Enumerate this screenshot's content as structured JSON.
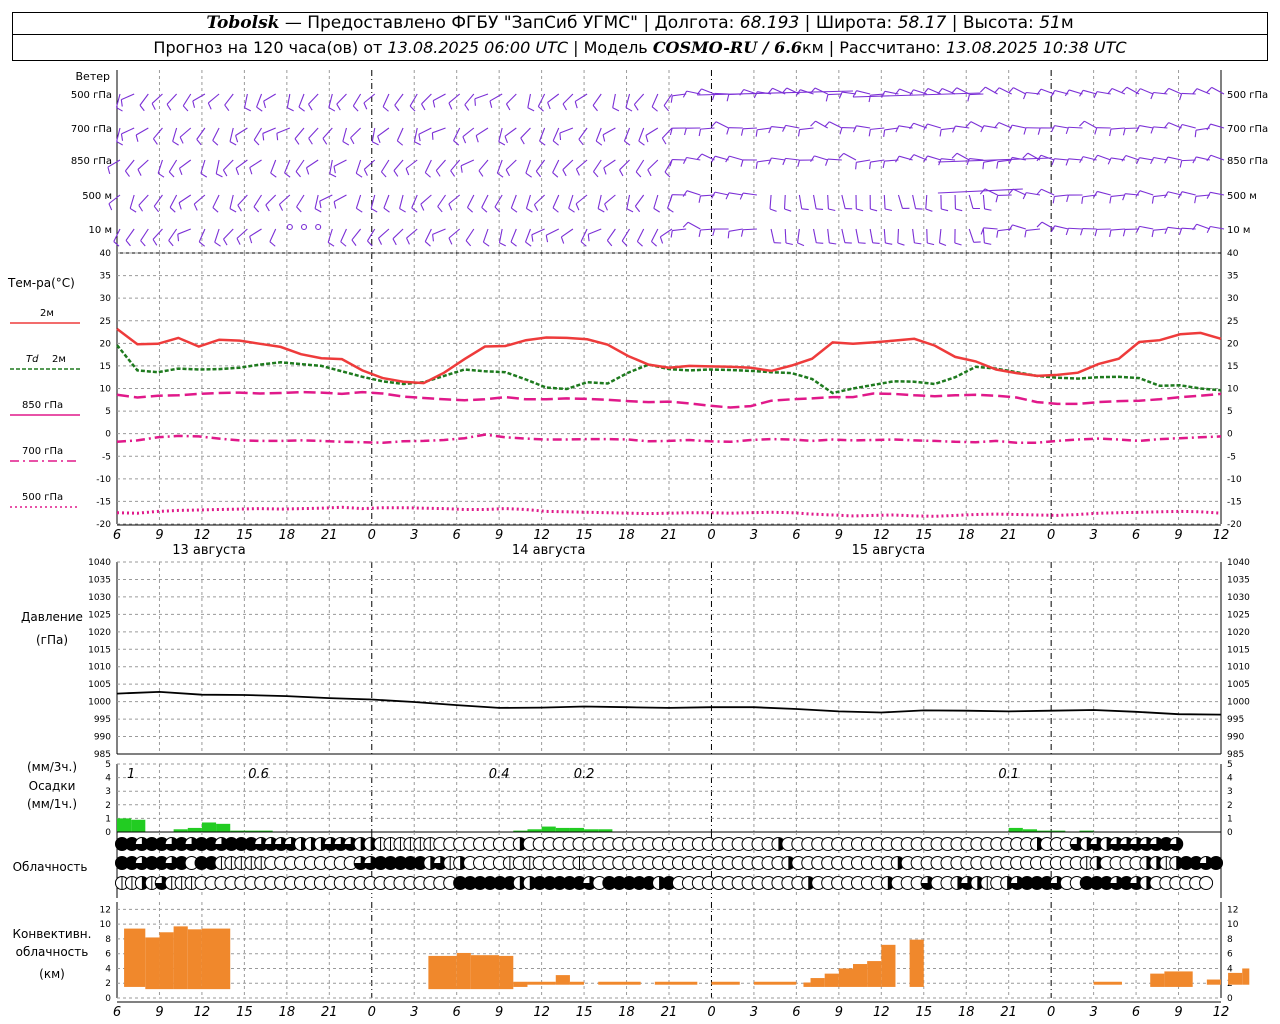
{
  "header": {
    "station": "Tobolsk",
    "provider": " — Предоставлено ФГБУ \"ЗапСиб УГМС\" | Долгота: ",
    "lon": "68.193",
    "lat_label": " | Широта: ",
    "lat": "58.17",
    "alt_label": " | Высота: ",
    "alt": "51",
    "alt_unit": "м",
    "forecast_prefix": "Прогноз на 120 часа(ов) от ",
    "forecast_date": "13.08.2025 06:00 UTC",
    "model_prefix": " | Модель ",
    "model": "COSMO-RU / 6.6",
    "model_unit": "км",
    "calc_prefix": " | Рассчитано: ",
    "calc_date": "13.08.2025 10:38 UTC"
  },
  "labels": {
    "wind": "Ветер",
    "wind_levels": [
      "500 гПа",
      "700 гПа",
      "850 гПа",
      "500 м",
      "10 м"
    ],
    "temp": "Тем-ра(°C)",
    "t2m": "2м",
    "td": "Td",
    "td2m": "2м",
    "t850": "850 гПа",
    "t700": "700 гПа",
    "t500": "500 гПа",
    "pressure": "Давление",
    "pressure_unit": "(гПа)",
    "precip_3h": "(мм/3ч.)",
    "precip": "Осадки",
    "precip_1h": "(мм/1ч.)",
    "cloud": "Облачность",
    "conv1": "Конвективн.",
    "conv2": "облачность",
    "conv3": "(км)",
    "dates": [
      "13 августа",
      "14 августа",
      "15 августа"
    ]
  },
  "colors": {
    "wind": "#7b2fd6",
    "t2m": "#ee3b3b",
    "td": "#1e7a1e",
    "t850": "#e0198a",
    "precip": "#22cc22",
    "conv": "#f0882c",
    "grid": "#9a9a9a"
  },
  "chart_data": {
    "type": "line",
    "hours": [
      6,
      9,
      12,
      15,
      18,
      21,
      0,
      3,
      6,
      9,
      12,
      15,
      18,
      21,
      0,
      3,
      6,
      9,
      12,
      15,
      18,
      21,
      0,
      3,
      6,
      9,
      12
    ],
    "temperature": {
      "ylim": [
        -20,
        40
      ],
      "ticks": [
        40,
        35,
        30,
        25,
        20,
        15,
        10,
        5,
        0,
        -5,
        -10,
        -15,
        -20
      ],
      "t2m": [
        23.2,
        19.8,
        19.9,
        21.2,
        19.3,
        20.8,
        20.6,
        19.9,
        19.2,
        17.6,
        16.7,
        16.5,
        14.0,
        12.3,
        11.5,
        11.2,
        13.5,
        16.5,
        19.3,
        19.4,
        20.7,
        21.3,
        21.2,
        20.9,
        19.7,
        17.2,
        15.3,
        14.6,
        15.0,
        14.9,
        14.8,
        14.6,
        13.9,
        15.1,
        16.6,
        20.2,
        19.9,
        20.2,
        20.6,
        21.0,
        19.5,
        17.0,
        16.0,
        14.2,
        13.4,
        12.8,
        13.0,
        13.5,
        15.4,
        16.6,
        20.3,
        20.7,
        22.0,
        22.3,
        21.0
      ],
      "td": [
        19.6,
        14.0,
        13.6,
        14.4,
        14.2,
        14.3,
        14.6,
        15.3,
        15.8,
        15.4,
        15.0,
        13.8,
        12.6,
        11.6,
        11.0,
        11.4,
        12.8,
        14.2,
        13.8,
        13.6,
        12.0,
        10.2,
        9.9,
        11.4,
        11.1,
        13.5,
        15.3,
        14.3,
        14.0,
        14.2,
        14.1,
        13.9,
        13.6,
        13.4,
        12.1,
        9.0,
        10.0,
        10.8,
        11.6,
        11.5,
        11.0,
        12.5,
        14.8,
        14.4,
        13.6,
        12.8,
        12.4,
        12.2,
        12.5,
        12.6,
        12.3,
        10.6,
        10.7,
        10.0,
        9.6
      ],
      "t850": [
        8.6,
        8.0,
        8.4,
        8.5,
        8.8,
        9.0,
        9.1,
        8.9,
        9.0,
        9.2,
        9.1,
        8.8,
        9.2,
        8.9,
        8.2,
        7.9,
        7.6,
        7.4,
        7.6,
        8.1,
        7.6,
        7.6,
        7.8,
        7.7,
        7.5,
        7.2,
        7.0,
        7.1,
        6.7,
        6.2,
        5.8,
        6.1,
        7.3,
        7.6,
        7.8,
        8.1,
        8.1,
        8.9,
        8.8,
        8.5,
        8.3,
        8.5,
        8.6,
        8.4,
        8.0,
        7.0,
        6.6,
        6.6,
        7.0,
        7.2,
        7.3,
        7.6,
        8.1,
        8.4,
        8.8
      ],
      "t700": [
        -1.8,
        -1.5,
        -0.8,
        -0.5,
        -0.6,
        -1.1,
        -1.5,
        -1.6,
        -1.6,
        -1.5,
        -1.6,
        -1.8,
        -1.9,
        -2.0,
        -1.7,
        -1.6,
        -1.4,
        -1.0,
        -0.2,
        -0.8,
        -1.1,
        -1.3,
        -1.3,
        -1.2,
        -1.2,
        -1.3,
        -1.7,
        -1.6,
        -1.4,
        -1.7,
        -1.8,
        -1.4,
        -1.2,
        -1.3,
        -1.6,
        -1.3,
        -1.5,
        -1.4,
        -1.3,
        -1.5,
        -1.6,
        -1.8,
        -1.9,
        -1.6,
        -2.0,
        -2.0,
        -1.6,
        -1.3,
        -1.1,
        -1.3,
        -1.6,
        -1.2,
        -1.0,
        -0.8,
        -0.6
      ],
      "t500": [
        -17.5,
        -17.6,
        -17.2,
        -17.0,
        -16.9,
        -16.8,
        -16.7,
        -16.6,
        -16.7,
        -16.6,
        -16.5,
        -16.3,
        -16.6,
        -16.4,
        -16.4,
        -16.5,
        -16.6,
        -16.8,
        -16.8,
        -16.6,
        -16.8,
        -17.2,
        -17.3,
        -17.4,
        -17.5,
        -17.6,
        -17.7,
        -17.6,
        -17.5,
        -17.5,
        -17.6,
        -17.5,
        -17.4,
        -17.5,
        -17.8,
        -18.0,
        -18.2,
        -18.1,
        -18.0,
        -18.2,
        -18.3,
        -18.1,
        -17.9,
        -17.8,
        -17.9,
        -18.0,
        -18.1,
        -17.9,
        -17.6,
        -17.5,
        -17.4,
        -17.3,
        -17.2,
        -17.3,
        -17.6
      ]
    },
    "pressure": {
      "ylim": [
        985,
        1040
      ],
      "ticks": [
        1040,
        1035,
        1030,
        1025,
        1020,
        1015,
        1010,
        1005,
        1000,
        995,
        990,
        985
      ],
      "values": [
        1002.3,
        1002.8,
        1002.0,
        1001.9,
        1001.6,
        1001.0,
        1000.6,
        999.9,
        999.0,
        998.2,
        998.3,
        998.6,
        998.4,
        998.2,
        998.4,
        998.4,
        997.9,
        997.2,
        996.9,
        997.5,
        997.4,
        997.2,
        997.4,
        997.6,
        997.1,
        996.4,
        996.3
      ]
    },
    "precip": {
      "ylim": [
        0,
        5
      ],
      "ticks": [
        5,
        4,
        3,
        2,
        1,
        0
      ],
      "labels_3h": [
        {
          "h": 1,
          "text": "1"
        },
        {
          "h": 10,
          "text": "0.6"
        },
        {
          "h": 27,
          "text": "0.4"
        },
        {
          "h": 33,
          "text": "0.2"
        },
        {
          "h": 63,
          "text": "0.1"
        }
      ],
      "hourly": [
        1.0,
        0.9,
        0.0,
        0.0,
        0.2,
        0.3,
        0.7,
        0.6,
        0.1,
        0.1,
        0.1,
        0.0,
        0.0,
        0.0,
        0.0,
        0.0,
        0.0,
        0.0,
        0.0,
        0.0,
        0.0,
        0.0,
        0.0,
        0.0,
        0.0,
        0.0,
        0.0,
        0.0,
        0.1,
        0.2,
        0.4,
        0.3,
        0.3,
        0.2,
        0.2,
        0.0,
        0.0,
        0.0,
        0.0,
        0.0,
        0.0,
        0.0,
        0.0,
        0.0,
        0.0,
        0.0,
        0.0,
        0.0,
        0.0,
        0.0,
        0.0,
        0.0,
        0.0,
        0.0,
        0.0,
        0.0,
        0.0,
        0.0,
        0.0,
        0.0,
        0.0,
        0.0,
        0.0,
        0.3,
        0.2,
        0.1,
        0.1,
        0.0,
        0.1,
        0.0,
        0.0,
        0.0
      ]
    },
    "clouds": {
      "high": [
        4,
        4,
        3,
        4,
        4,
        3,
        4,
        3,
        4,
        4,
        3,
        4,
        4,
        4,
        3,
        3,
        3,
        3,
        2,
        2,
        2,
        3,
        3,
        3,
        2,
        2,
        1,
        1,
        1,
        1,
        1,
        1,
        0,
        0,
        0,
        0,
        0,
        0,
        0,
        0,
        2,
        0,
        0,
        0,
        0,
        0,
        0,
        0,
        0,
        0,
        0,
        0,
        0,
        0,
        0,
        0,
        0,
        0,
        0,
        0,
        0,
        0,
        0,
        0,
        0,
        0,
        2,
        0,
        0,
        0,
        0,
        0,
        0,
        0,
        0,
        0,
        0,
        0,
        0,
        0,
        0,
        0,
        0,
        0,
        0,
        0,
        0,
        0,
        0,
        0,
        0,
        0,
        2,
        0,
        0,
        0,
        3,
        2,
        3,
        2,
        3,
        3,
        3,
        3,
        3,
        4,
        3
      ],
      "mid": [
        4,
        4,
        3,
        4,
        4,
        3,
        4,
        0,
        4,
        4,
        1,
        1,
        1,
        1,
        1,
        0,
        0,
        0,
        0,
        0,
        0,
        0,
        0,
        0,
        3,
        3,
        4,
        4,
        4,
        4,
        4,
        2,
        3,
        1,
        2,
        0,
        0,
        0,
        0,
        1,
        0,
        1,
        0,
        0,
        0,
        0,
        1,
        0,
        0,
        0,
        0,
        0,
        0,
        0,
        0,
        0,
        0,
        0,
        0,
        0,
        0,
        0,
        0,
        0,
        0,
        0,
        0,
        2,
        0,
        0,
        0,
        0,
        0,
        0,
        0,
        0,
        0,
        0,
        2,
        0,
        0,
        0,
        0,
        0,
        0,
        0,
        0,
        0,
        0,
        0,
        0,
        0,
        0,
        0,
        0,
        0,
        0,
        1,
        2,
        0,
        0,
        0,
        0,
        2,
        2,
        1,
        2,
        4,
        4,
        3,
        4
      ],
      "low": [
        1,
        1,
        2,
        1,
        3,
        1,
        1,
        1,
        0,
        0,
        0,
        0,
        0,
        0,
        0,
        0,
        0,
        0,
        0,
        0,
        0,
        0,
        0,
        0,
        0,
        0,
        0,
        0,
        0,
        0,
        0,
        0,
        0,
        0,
        4,
        4,
        4,
        4,
        4,
        4,
        2,
        2,
        4,
        4,
        4,
        4,
        4,
        3,
        0,
        4,
        4,
        4,
        4,
        4,
        2,
        4,
        0,
        0,
        0,
        0,
        0,
        0,
        0,
        0,
        0,
        0,
        0,
        0,
        0,
        2,
        0,
        0,
        0,
        0,
        0,
        0,
        0,
        2,
        0,
        0,
        0,
        3,
        0,
        0,
        2,
        3,
        2,
        1,
        0,
        2,
        3,
        4,
        4,
        4,
        3,
        0,
        0,
        4,
        4,
        4,
        3,
        4,
        3,
        2,
        0,
        0,
        0,
        0,
        0,
        0
      ]
    },
    "convective": {
      "ylim": [
        0,
        13
      ],
      "ticks": [
        12,
        10,
        8,
        6,
        4,
        2,
        0
      ],
      "segments": [
        {
          "h0": 0.5,
          "h1": 2,
          "base": 1.5,
          "top": 9.4
        },
        {
          "h0": 2,
          "h1": 3,
          "base": 1.2,
          "top": 8.2
        },
        {
          "h0": 3,
          "h1": 4,
          "base": 1.2,
          "top": 8.9
        },
        {
          "h0": 4,
          "h1": 5,
          "base": 1.2,
          "top": 9.7
        },
        {
          "h0": 5,
          "h1": 6,
          "base": 1.2,
          "top": 9.3
        },
        {
          "h0": 6,
          "h1": 8,
          "base": 1.2,
          "top": 9.4
        },
        {
          "h0": 22,
          "h1": 24,
          "base": 1.2,
          "top": 5.7
        },
        {
          "h0": 24,
          "h1": 25,
          "base": 1.2,
          "top": 6.1
        },
        {
          "h0": 25,
          "h1": 27,
          "base": 1.2,
          "top": 5.8
        },
        {
          "h0": 27,
          "h1": 28,
          "base": 1.2,
          "top": 5.7
        },
        {
          "h0": 28,
          "h1": 29,
          "base": 1.5,
          "top": 2.2
        },
        {
          "h0": 29,
          "h1": 31,
          "base": 1.8,
          "top": 2.2
        },
        {
          "h0": 31,
          "h1": 32,
          "base": 1.8,
          "top": 3.1
        },
        {
          "h0": 32,
          "h1": 33,
          "base": 1.8,
          "top": 2.2
        },
        {
          "h0": 34,
          "h1": 37,
          "base": 1.8,
          "top": 2.2
        },
        {
          "h0": 38,
          "h1": 41,
          "base": 1.8,
          "top": 2.2
        },
        {
          "h0": 42,
          "h1": 44,
          "base": 1.8,
          "top": 2.2
        },
        {
          "h0": 45,
          "h1": 48,
          "base": 1.8,
          "top": 2.2
        },
        {
          "h0": 48.5,
          "h1": 49,
          "base": 1.5,
          "top": 2.1
        },
        {
          "h0": 49,
          "h1": 50,
          "base": 1.5,
          "top": 2.7
        },
        {
          "h0": 50,
          "h1": 51,
          "base": 1.5,
          "top": 3.3
        },
        {
          "h0": 51,
          "h1": 52,
          "base": 1.5,
          "top": 4.0
        },
        {
          "h0": 52,
          "h1": 53,
          "base": 1.5,
          "top": 4.6
        },
        {
          "h0": 53,
          "h1": 54,
          "base": 1.5,
          "top": 5.0
        },
        {
          "h0": 54,
          "h1": 55,
          "base": 1.5,
          "top": 7.2
        },
        {
          "h0": 56,
          "h1": 57,
          "base": 1.5,
          "top": 7.9
        },
        {
          "h0": 69,
          "h1": 71,
          "base": 1.8,
          "top": 2.2
        },
        {
          "h0": 73,
          "h1": 74,
          "base": 1.5,
          "top": 3.3
        },
        {
          "h0": 74,
          "h1": 76,
          "base": 1.5,
          "top": 3.6
        },
        {
          "h0": 77,
          "h1": 78,
          "base": 1.8,
          "top": 2.5
        },
        {
          "h0": 78.5,
          "h1": 79.5,
          "base": 1.8,
          "top": 3.4
        },
        {
          "h0": 79.5,
          "h1": 80,
          "base": 1.8,
          "top": 4.0
        }
      ]
    }
  }
}
